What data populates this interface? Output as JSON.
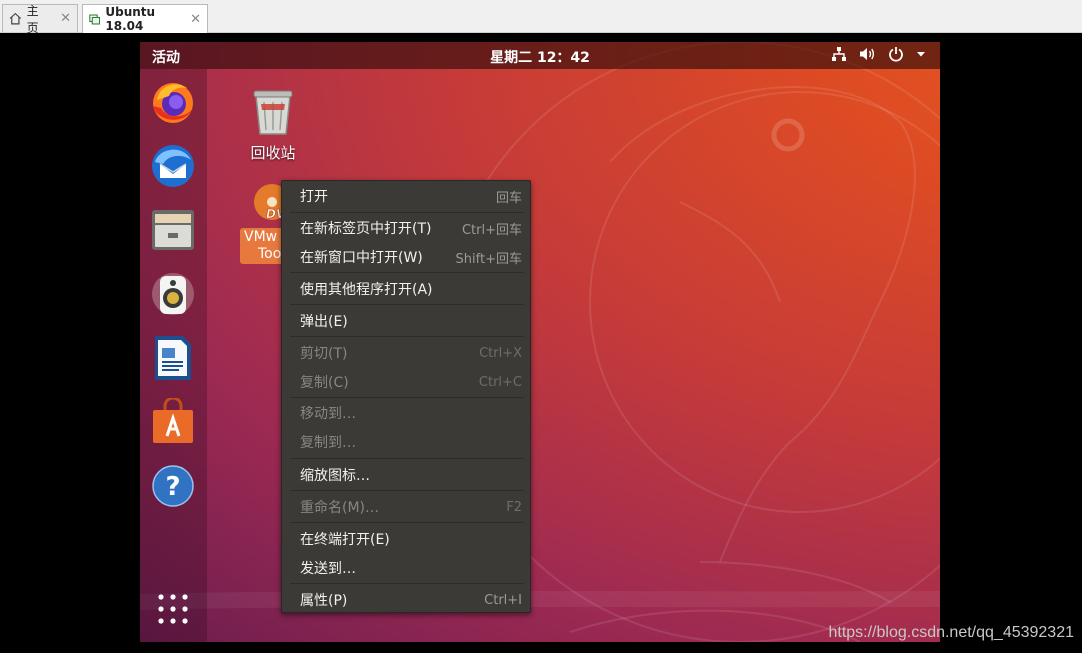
{
  "host": {
    "tabs": [
      {
        "label": "主页",
        "icon": "home-icon"
      },
      {
        "label": "Ubuntu 18.04",
        "icon": "vm-icon"
      }
    ],
    "close_glyph": "✕"
  },
  "topbar": {
    "activities": "活动",
    "clock": "星期二 12：42",
    "tray_icons": [
      "network-icon",
      "volume-icon",
      "power-icon",
      "chevron-down-icon"
    ]
  },
  "dock": {
    "apps": [
      "firefox-icon",
      "thunderbird-icon",
      "files-icon",
      "rhythmbox-icon",
      "writer-icon",
      "software-icon",
      "help-icon",
      "show-apps-icon"
    ]
  },
  "desktop": {
    "trash_label": "回收站",
    "dvd_label_line1": "VMw",
    "dvd_label_line2": "Too"
  },
  "menu": {
    "items": [
      {
        "label": "打开",
        "shortcut": "回车",
        "disabled": false
      },
      {
        "label": "在新标签页中打开(T)",
        "shortcut": "Ctrl+回车",
        "disabled": false
      },
      {
        "label": "在新窗口中打开(W)",
        "shortcut": "Shift+回车",
        "disabled": false
      },
      {
        "label": "使用其他程序打开(A)",
        "shortcut": "",
        "disabled": false
      },
      {
        "label": "弹出(E)",
        "shortcut": "",
        "disabled": false
      },
      {
        "label": "剪切(T)",
        "shortcut": "Ctrl+X",
        "disabled": true
      },
      {
        "label": "复制(C)",
        "shortcut": "Ctrl+C",
        "disabled": true
      },
      {
        "label": "移动到…",
        "shortcut": "",
        "disabled": true
      },
      {
        "label": "复制到…",
        "shortcut": "",
        "disabled": true
      },
      {
        "label": "缩放图标…",
        "shortcut": "",
        "disabled": false
      },
      {
        "label": "重命名(M)…",
        "shortcut": "F2",
        "disabled": true
      },
      {
        "label": "在终端打开(E)",
        "shortcut": "",
        "disabled": false
      },
      {
        "label": "发送到…",
        "shortcut": "",
        "disabled": false
      },
      {
        "label": "属性(P)",
        "shortcut": "Ctrl+I",
        "disabled": false
      }
    ]
  },
  "watermark": "https://blog.csdn.net/qq_45392321",
  "colors": {
    "desktop_orange": "#e6561f",
    "desktop_purple": "#6c1d4f",
    "menu_bg": "#3b3a36",
    "selection": "#e8793e"
  }
}
